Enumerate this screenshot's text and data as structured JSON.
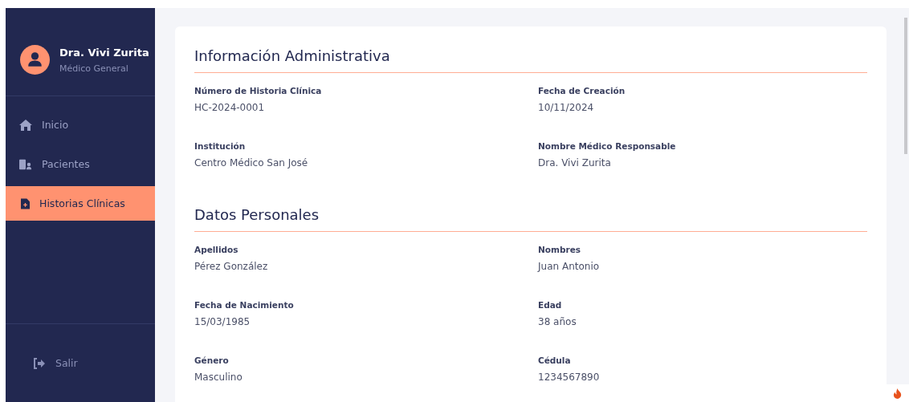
{
  "user": {
    "name": "Dra. Vivi Zurita",
    "role": "Médico General"
  },
  "menu": [
    {
      "label": "Inicio",
      "kind": "home",
      "selected": false
    },
    {
      "label": "Pacientes",
      "kind": "patients",
      "selected": false
    },
    {
      "label": "Historias Clínicas",
      "kind": "file",
      "selected": true
    }
  ],
  "logout": {
    "label": "Salir"
  },
  "sections": [
    {
      "title": "Información Administrativa",
      "fields": [
        {
          "label": "Número de Historia Clínica",
          "value": "HC-2024-0001"
        },
        {
          "label": "Fecha de Creación",
          "value": "10/11/2024"
        },
        {
          "label": "Institución",
          "value": "Centro Médico San José"
        },
        {
          "label": "Nombre Médico Responsable",
          "value": "Dra. Vivi Zurita"
        }
      ]
    },
    {
      "title": "Datos Personales",
      "fields": [
        {
          "label": "Apellidos",
          "value": "Pérez González"
        },
        {
          "label": "Nombres",
          "value": "Juan Antonio"
        },
        {
          "label": "Fecha de Nacimiento",
          "value": "15/03/1985"
        },
        {
          "label": "Edad",
          "value": "38 años"
        },
        {
          "label": "Género",
          "value": "Masculino"
        },
        {
          "label": "Cédula",
          "value": "1234567890"
        }
      ]
    }
  ]
}
